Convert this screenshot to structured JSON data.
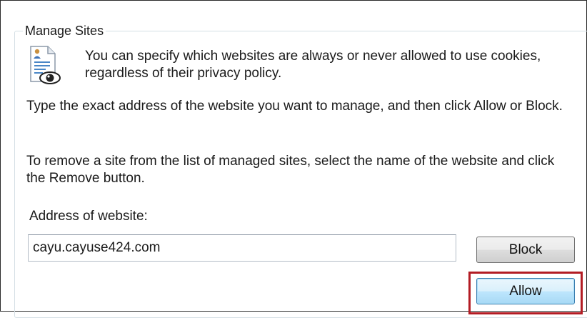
{
  "group": {
    "title": "Manage Sites"
  },
  "intro_text": "You can specify which websites are always or never allowed to use cookies, regardless of their privacy policy.",
  "instructions": {
    "manage": "Type the exact address of the website you want to manage, and then click Allow or Block.",
    "remove": "To remove a site from the list of managed sites, select the name of the website and click the Remove button."
  },
  "address": {
    "label": "Address of website:",
    "value": "cayu.cayuse424.com"
  },
  "buttons": {
    "block_label": "Block",
    "allow_label": "Allow"
  },
  "icons": {
    "privacy_document": "privacy-document-eye-icon"
  },
  "colors": {
    "highlight_border": "#b31c24",
    "focused_button_border": "#3c7fb1"
  }
}
